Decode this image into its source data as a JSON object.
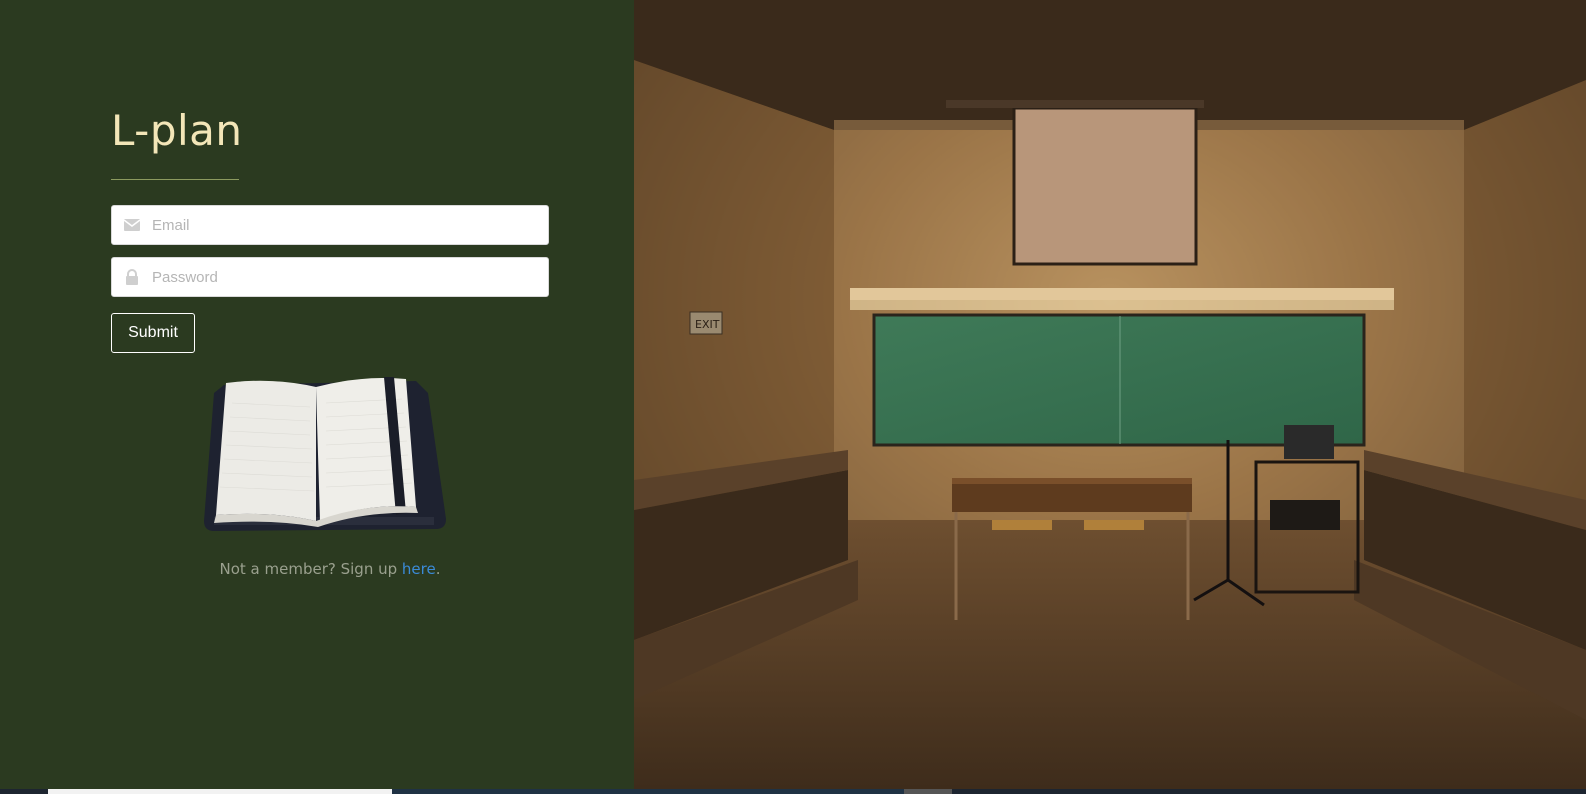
{
  "brand": {
    "title": "L-plan"
  },
  "form": {
    "email": {
      "placeholder": "Email",
      "icon": "envelope-icon"
    },
    "password": {
      "placeholder": "Password",
      "icon": "lock-icon"
    },
    "submit_label": "Submit"
  },
  "signup": {
    "prefix": "Not a member? Sign up ",
    "link_text": "here",
    "suffix": "."
  },
  "colors": {
    "panel_bg": "#2b3a20",
    "brand": "#f3e6b8",
    "link": "#3b8ad6"
  },
  "images": {
    "notebook": "open notebook illustration",
    "hero": "empty lecture hall with chalkboard"
  }
}
